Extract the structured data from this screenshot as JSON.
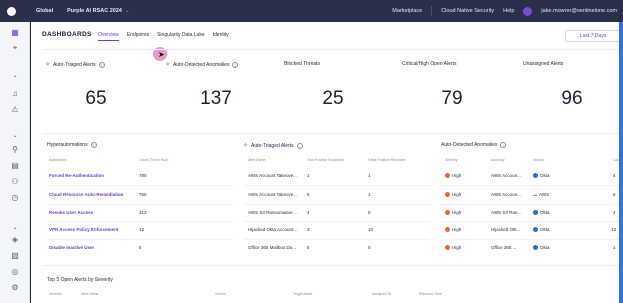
{
  "topbar": {
    "account": "Global",
    "site": "Purple AI RSAC 2024",
    "links": [
      "Marketplace",
      "Cloud Native Security",
      "Help"
    ],
    "user": "jake.mowrer@sentinelone.com"
  },
  "header": {
    "title": "DASHBOARDS",
    "tabs": [
      "Overview",
      "Endpoints",
      "Singularity Data Lake",
      "Identity"
    ],
    "active_tab": "Overview",
    "time_range": "Last 7 Days"
  },
  "kpis": [
    {
      "label": "Auto-Triaged Alerts",
      "value": "65"
    },
    {
      "label": "Auto-Detected Anomalies",
      "value": "137"
    },
    {
      "label": "Blocked Threats",
      "value": "25"
    },
    {
      "label": "Critical/High Open Alerts",
      "value": "79"
    },
    {
      "label": "Unassigned Alerts",
      "value": "96"
    }
  ],
  "hyperautomations": {
    "title": "Hyperautomations",
    "columns": [
      "Automation",
      "Count (Times Run)"
    ],
    "rows": [
      {
        "name": "Forced Re-Authentication",
        "count": "780"
      },
      {
        "name": "Cloud Resource Auto-Remediation",
        "count": "760"
      },
      {
        "name": "Revoke User Access",
        "count": "312"
      },
      {
        "name": "VPN Access Policy Enforcement",
        "count": "12"
      },
      {
        "name": "Disable Inactive User",
        "count": "5"
      }
    ]
  },
  "auto_triaged": {
    "title": "Auto-Triaged Alerts",
    "columns": [
      "Alert Name",
      "True Positive Escalated",
      "False Positive Resolved"
    ],
    "rows": [
      {
        "name": "AWS Account Takeove...",
        "tp": "1",
        "fp": "1"
      },
      {
        "name": "AWS Account Takeove...",
        "tp": "5",
        "fp": "1"
      },
      {
        "name": "AWS S3 Ransomware ...",
        "tp": "4",
        "fp": "0"
      },
      {
        "name": "Hijacked Okta Account...",
        "tp": "3",
        "fp": "10"
      },
      {
        "name": "Office 365 Mailbox Da...",
        "tp": "5",
        "fp": "0"
      }
    ]
  },
  "anomalies": {
    "title": "Auto-Detected Anomalies",
    "columns": [
      "Severity",
      "Anomaly",
      "Vendor",
      "Count"
    ],
    "rows": [
      {
        "severity": "High",
        "anomaly": "AWS Accoun...",
        "vendor": "Okta",
        "count": "4"
      },
      {
        "severity": "High",
        "anomaly": "AWS Accoun...",
        "vendor": "AWS",
        "count": "6"
      },
      {
        "severity": "High",
        "anomaly": "AWS S3 Ran...",
        "vendor": "Okta",
        "count": "4"
      },
      {
        "severity": "High",
        "anomaly": "Hijacked Okt...",
        "vendor": "Okta",
        "count": "13"
      },
      {
        "severity": "High",
        "anomaly": "Office 365 ...",
        "vendor": "Okta",
        "count": "1"
      }
    ]
  },
  "bottom": {
    "title": "Top 5 Open Alerts by Severity",
    "columns": [
      "Severity",
      "Alert Name",
      "Vendor",
      "Target Asset",
      "Assigned To",
      "Reported Time"
    ]
  },
  "colors": {
    "accent": "#6a3fd6",
    "topbar": "#2a2f4a",
    "severity_high": "#e8663d",
    "vendor_okta": "#2d6ad8"
  }
}
